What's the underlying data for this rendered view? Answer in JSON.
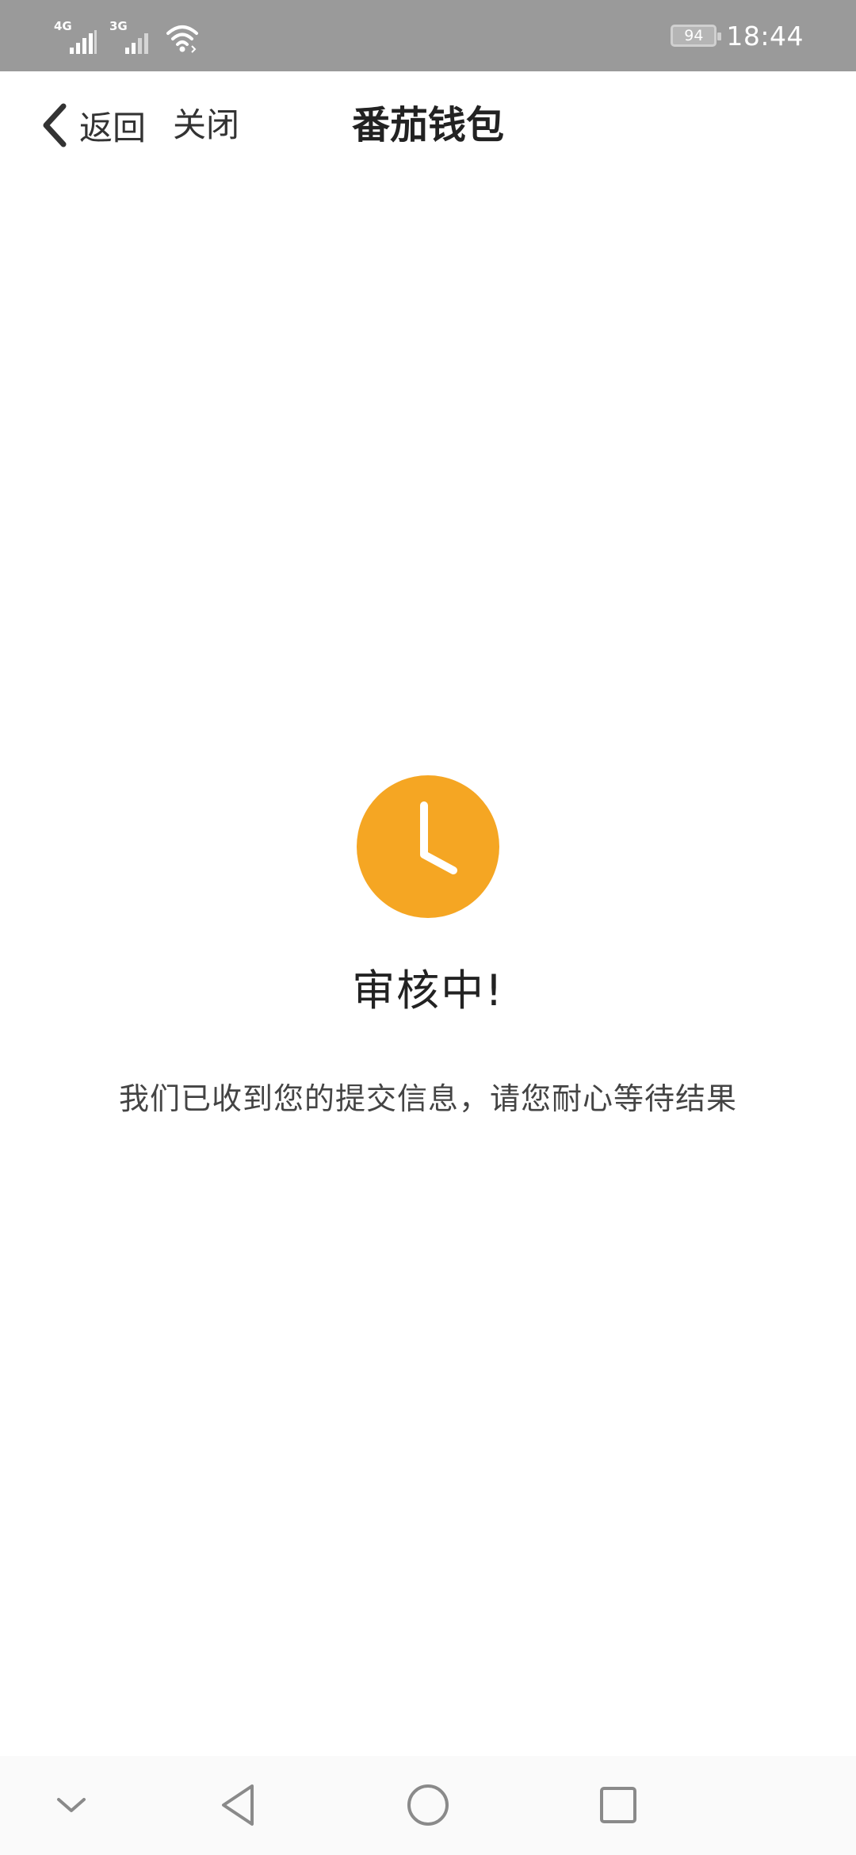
{
  "status_bar": {
    "network_1": "4G",
    "network_2": "3G",
    "battery_level": "94",
    "time": "18:44",
    "icons": [
      "signal-4g-icon",
      "signal-3g-icon",
      "wifi-icon",
      "battery-icon"
    ]
  },
  "nav": {
    "back_label": "返回",
    "close_label": "关闭",
    "title": "番茄钱包",
    "back_icon": "chevron-left-icon"
  },
  "main": {
    "icon": "clock-icon",
    "icon_color": "#F5A623",
    "title": "审核中!",
    "description": "我们已收到您的提交信息，请您耐心等待结果"
  },
  "system_nav": {
    "icons": [
      "chevron-down-icon",
      "back-triangle-icon",
      "home-circle-icon",
      "recents-square-icon"
    ]
  }
}
